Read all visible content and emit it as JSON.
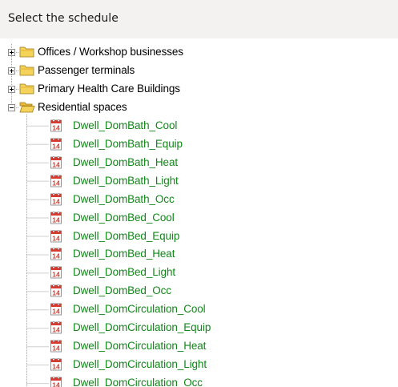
{
  "header": {
    "title": "Select the schedule"
  },
  "tree": {
    "folders": [
      {
        "label": "Offices / Workshop businesses",
        "expanded": false,
        "icon": "folder-icon"
      },
      {
        "label": "Passenger terminals",
        "expanded": false,
        "icon": "folder-icon"
      },
      {
        "label": "Primary Health Care Buildings",
        "expanded": false,
        "icon": "folder-icon"
      },
      {
        "label": "Residential spaces",
        "expanded": true,
        "icon": "folder-open-icon"
      }
    ],
    "schedules": [
      "Dwell_DomBath_Cool",
      "Dwell_DomBath_Equip",
      "Dwell_DomBath_Heat",
      "Dwell_DomBath_Light",
      "Dwell_DomBath_Occ",
      "Dwell_DomBed_Cool",
      "Dwell_DomBed_Equip",
      "Dwell_DomBed_Heat",
      "Dwell_DomBed_Light",
      "Dwell_DomBed_Occ",
      "Dwell_DomCirculation_Cool",
      "Dwell_DomCirculation_Equip",
      "Dwell_DomCirculation_Heat",
      "Dwell_DomCirculation_Light",
      "Dwell_DomCirculation_Occ"
    ],
    "schedule_icon": "calendar-icon",
    "calendar_day": "14",
    "colors": {
      "schedule_text": "#12871a",
      "folder_yellow": "#f4d35a",
      "calendar_red": "#d83a2f"
    }
  }
}
